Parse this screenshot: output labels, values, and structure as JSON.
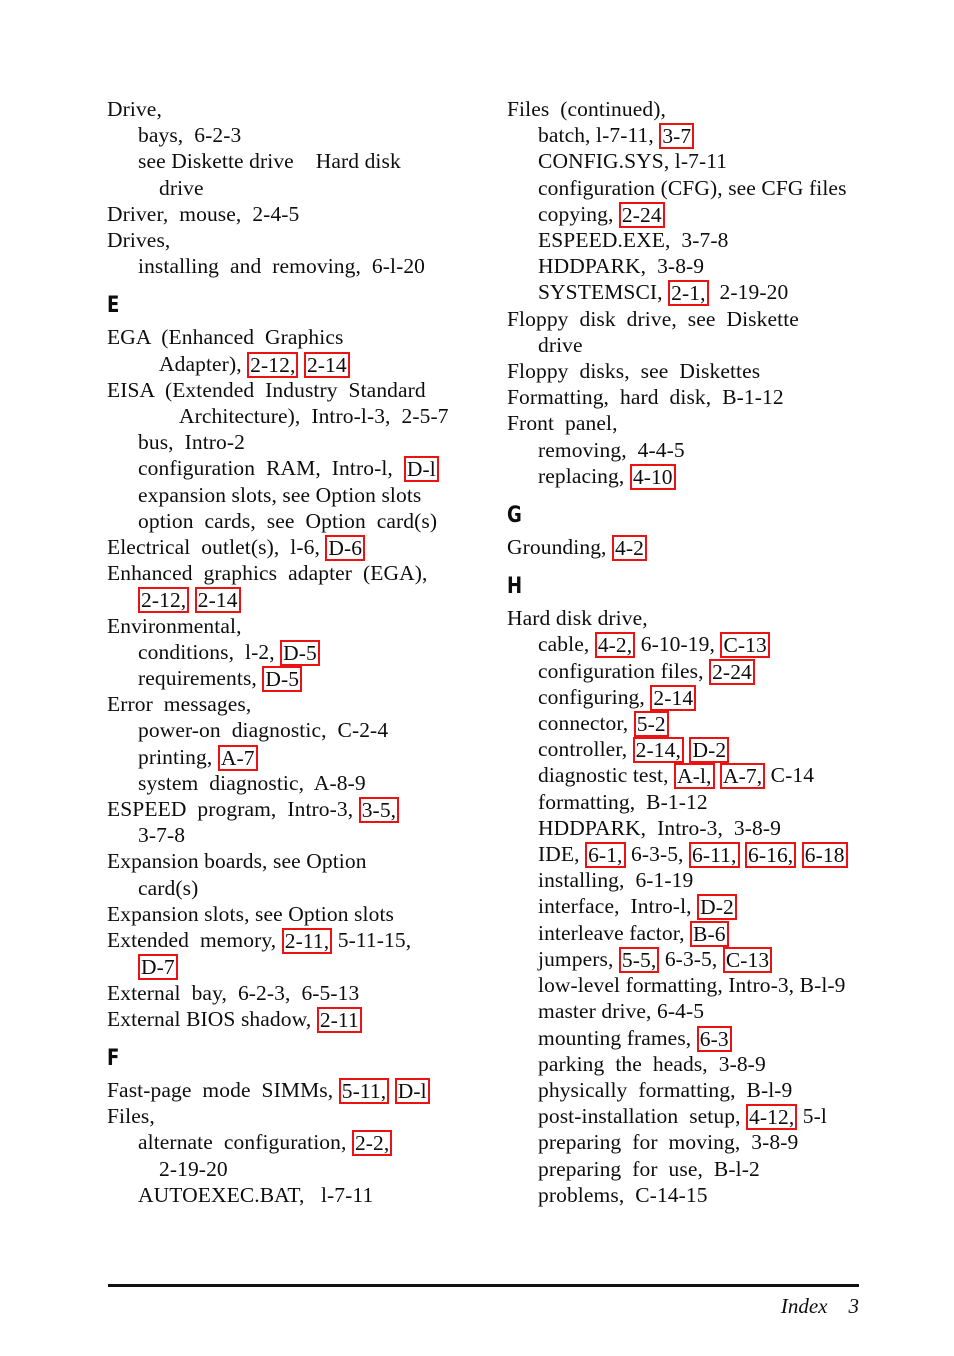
{
  "page": {
    "footer_label": "Index",
    "footer_page_number": "3",
    "highlight_color": "#ee1111"
  },
  "columns": [
    {
      "name": "left-column",
      "blocks": [
        {
          "type": "entries",
          "lines": [
            {
              "indent": 0,
              "parts": [
                {
                  "t": "Drive,"
                }
              ]
            },
            {
              "indent": 1,
              "parts": [
                {
                  "t": "bays,  6-2-3"
                }
              ]
            },
            {
              "indent": 1,
              "parts": [
                {
                  "t": "see Diskette drive    Hard disk"
                }
              ]
            },
            {
              "indent": 2,
              "parts": [
                {
                  "t": "drive"
                }
              ]
            },
            {
              "indent": 0,
              "parts": [
                {
                  "t": "Driver,  mouse,  2-4-5"
                }
              ]
            },
            {
              "indent": 0,
              "parts": [
                {
                  "t": "Drives,"
                }
              ]
            },
            {
              "indent": 1,
              "parts": [
                {
                  "t": "installing  and  removing,  6-l-20"
                }
              ]
            }
          ]
        },
        {
          "type": "section",
          "letter": "E"
        },
        {
          "type": "entries",
          "lines": [
            {
              "indent": 0,
              "parts": [
                {
                  "t": "EGA  (Enhanced  Graphics"
                }
              ]
            },
            {
              "indent": 2,
              "parts": [
                {
                  "t": "Adapter), "
                },
                {
                  "t": "2-12,",
                  "box": true
                },
                {
                  "t": " "
                },
                {
                  "t": "2-14",
                  "box": true
                }
              ]
            },
            {
              "indent": 0,
              "parts": [
                {
                  "t": "EISA  (Extended  Industry  Standard"
                }
              ]
            },
            {
              "indent": 3,
              "parts": [
                {
                  "t": "Architecture),  Intro-l-3,  2-5-7"
                }
              ]
            },
            {
              "indent": 1,
              "parts": [
                {
                  "t": "bus,  Intro-2"
                }
              ]
            },
            {
              "indent": 1,
              "parts": [
                {
                  "t": "configuration  RAM,  Intro-l,  "
                },
                {
                  "t": "D-l",
                  "box": true
                }
              ]
            },
            {
              "indent": 1,
              "parts": [
                {
                  "t": "expansion slots, see Option slots"
                }
              ]
            },
            {
              "indent": 1,
              "parts": [
                {
                  "t": "option  cards,  see  Option  card(s)"
                }
              ]
            },
            {
              "indent": 0,
              "parts": [
                {
                  "t": "Electrical  outlet(s),  l-6, "
                },
                {
                  "t": "D-6",
                  "box": true
                }
              ]
            },
            {
              "indent": 0,
              "parts": [
                {
                  "t": "Enhanced  graphics  adapter  (EGA),"
                }
              ]
            },
            {
              "indent": 1,
              "parts": [
                {
                  "t": "2-12,",
                  "box": true
                },
                {
                  "t": " "
                },
                {
                  "t": "2-14",
                  "box": true
                }
              ]
            },
            {
              "indent": 0,
              "parts": [
                {
                  "t": "Environmental,"
                }
              ]
            },
            {
              "indent": 1,
              "parts": [
                {
                  "t": "conditions,  l-2, "
                },
                {
                  "t": "D-5",
                  "box": true
                }
              ]
            },
            {
              "indent": 1,
              "parts": [
                {
                  "t": "requirements, "
                },
                {
                  "t": "D-5",
                  "box": true
                }
              ]
            },
            {
              "indent": 0,
              "parts": [
                {
                  "t": "Error  messages,"
                }
              ]
            },
            {
              "indent": 1,
              "parts": [
                {
                  "t": "power-on  diagnostic,  C-2-4"
                }
              ]
            },
            {
              "indent": 1,
              "parts": [
                {
                  "t": "printing, "
                },
                {
                  "t": "A-7",
                  "box": true
                }
              ]
            },
            {
              "indent": 1,
              "parts": [
                {
                  "t": "system  diagnostic,  A-8-9"
                }
              ]
            },
            {
              "indent": 0,
              "parts": [
                {
                  "t": "ESPEED  program,  Intro-3, "
                },
                {
                  "t": "3-5,",
                  "box": true
                }
              ]
            },
            {
              "indent": 1,
              "parts": [
                {
                  "t": "3-7-8"
                }
              ]
            },
            {
              "indent": 0,
              "parts": [
                {
                  "t": "Expansion boards, see Option"
                }
              ]
            },
            {
              "indent": 1,
              "parts": [
                {
                  "t": "card(s)"
                }
              ]
            },
            {
              "indent": 0,
              "parts": [
                {
                  "t": "Expansion slots, see Option slots"
                }
              ]
            },
            {
              "indent": 0,
              "parts": [
                {
                  "t": "Extended  memory, "
                },
                {
                  "t": "2-11,",
                  "box": true
                },
                {
                  "t": " 5-11-15,"
                }
              ]
            },
            {
              "indent": 1,
              "parts": [
                {
                  "t": "D-7",
                  "box": true
                }
              ]
            },
            {
              "indent": 0,
              "parts": [
                {
                  "t": "External  bay,  6-2-3,  6-5-13"
                }
              ]
            },
            {
              "indent": 0,
              "parts": [
                {
                  "t": "External BIOS shadow, "
                },
                {
                  "t": "2-11",
                  "box": true
                }
              ]
            }
          ]
        },
        {
          "type": "section",
          "letter": "F"
        },
        {
          "type": "entries",
          "lines": [
            {
              "indent": 0,
              "parts": [
                {
                  "t": "Fast-page  mode  SIMMs, "
                },
                {
                  "t": "5-11,",
                  "box": true
                },
                {
                  "t": " "
                },
                {
                  "t": "D-l",
                  "box": true
                }
              ]
            },
            {
              "indent": 0,
              "parts": [
                {
                  "t": "Files,"
                }
              ]
            },
            {
              "indent": 1,
              "parts": [
                {
                  "t": "alternate  configuration, "
                },
                {
                  "t": "2-2,",
                  "box": true
                }
              ]
            },
            {
              "indent": 2,
              "parts": [
                {
                  "t": "2-19-20"
                }
              ]
            },
            {
              "indent": 1,
              "parts": [
                {
                  "t": "AUTOEXEC.BAT,   l-7-11"
                }
              ]
            }
          ]
        }
      ]
    },
    {
      "name": "right-column",
      "blocks": [
        {
          "type": "entries",
          "lines": [
            {
              "indent": 0,
              "parts": [
                {
                  "t": "Files  (continued),"
                }
              ]
            },
            {
              "indent": 1,
              "parts": [
                {
                  "t": "batch, l-7-11, "
                },
                {
                  "t": "3-7",
                  "box": true
                }
              ]
            },
            {
              "indent": 1,
              "parts": [
                {
                  "t": "CONFIG.SYS, l-7-11"
                }
              ]
            },
            {
              "indent": 1,
              "parts": [
                {
                  "t": "configuration (CFG), see CFG files"
                }
              ]
            },
            {
              "indent": 1,
              "parts": [
                {
                  "t": "copying, "
                },
                {
                  "t": "2-24",
                  "box": true
                }
              ]
            },
            {
              "indent": 1,
              "parts": [
                {
                  "t": "ESPEED.EXE,  3-7-8"
                }
              ]
            },
            {
              "indent": 1,
              "parts": [
                {
                  "t": "HDDPARK,  3-8-9"
                }
              ]
            },
            {
              "indent": 1,
              "parts": [
                {
                  "t": "SYSTEMSCI, "
                },
                {
                  "t": "2-1,",
                  "box": true
                },
                {
                  "t": "  2-19-20"
                }
              ]
            },
            {
              "indent": 0,
              "parts": [
                {
                  "t": "Floppy  disk  drive,  see  Diskette"
                }
              ]
            },
            {
              "indent": 1,
              "parts": [
                {
                  "t": "drive"
                }
              ]
            },
            {
              "indent": 0,
              "parts": [
                {
                  "t": "Floppy  disks,  see  Diskettes"
                }
              ]
            },
            {
              "indent": 0,
              "parts": [
                {
                  "t": "Formatting,  hard  disk,  B-1-12"
                }
              ]
            },
            {
              "indent": 0,
              "parts": [
                {
                  "t": "Front  panel,"
                }
              ]
            },
            {
              "indent": 1,
              "parts": [
                {
                  "t": "removing,  4-4-5"
                }
              ]
            },
            {
              "indent": 1,
              "parts": [
                {
                  "t": "replacing, "
                },
                {
                  "t": "4-10",
                  "box": true
                }
              ]
            }
          ]
        },
        {
          "type": "section",
          "letter": "G"
        },
        {
          "type": "entries",
          "lines": [
            {
              "indent": 0,
              "parts": [
                {
                  "t": "Grounding, "
                },
                {
                  "t": "4-2",
                  "box": true
                }
              ]
            }
          ]
        },
        {
          "type": "section",
          "letter": "H"
        },
        {
          "type": "entries",
          "lines": [
            {
              "indent": 0,
              "parts": [
                {
                  "t": "Hard disk drive,"
                }
              ]
            },
            {
              "indent": 1,
              "parts": [
                {
                  "t": "cable, "
                },
                {
                  "t": "4-2,",
                  "box": true
                },
                {
                  "t": " 6-10-19, "
                },
                {
                  "t": "C-13",
                  "box": true
                }
              ]
            },
            {
              "indent": 1,
              "parts": [
                {
                  "t": "configuration files, "
                },
                {
                  "t": "2-24",
                  "box": true
                }
              ]
            },
            {
              "indent": 1,
              "parts": [
                {
                  "t": "configuring, "
                },
                {
                  "t": "2-14",
                  "box": true
                }
              ]
            },
            {
              "indent": 1,
              "parts": [
                {
                  "t": "connector, "
                },
                {
                  "t": "5-2",
                  "box": true
                }
              ]
            },
            {
              "indent": 1,
              "parts": [
                {
                  "t": "controller, "
                },
                {
                  "t": "2-14,",
                  "box": true
                },
                {
                  "t": " "
                },
                {
                  "t": "D-2",
                  "box": true
                }
              ]
            },
            {
              "indent": 1,
              "parts": [
                {
                  "t": "diagnostic test, "
                },
                {
                  "t": "A-l,",
                  "box": true
                },
                {
                  "t": " "
                },
                {
                  "t": "A-7,",
                  "box": true
                },
                {
                  "t": " C-14"
                }
              ]
            },
            {
              "indent": 1,
              "parts": [
                {
                  "t": "formatting,  B-1-12"
                }
              ]
            },
            {
              "indent": 1,
              "parts": [
                {
                  "t": "HDDPARK,  Intro-3,  3-8-9"
                }
              ]
            },
            {
              "indent": 1,
              "parts": [
                {
                  "t": "IDE, "
                },
                {
                  "t": "6-1,",
                  "box": true
                },
                {
                  "t": " 6-3-5, "
                },
                {
                  "t": "6-11,",
                  "box": true
                },
                {
                  "t": " "
                },
                {
                  "t": "6-16,",
                  "box": true
                },
                {
                  "t": " "
                },
                {
                  "t": "6-18",
                  "box": true
                }
              ]
            },
            {
              "indent": 1,
              "parts": [
                {
                  "t": "installing,  6-1-19"
                }
              ]
            },
            {
              "indent": 1,
              "parts": [
                {
                  "t": "interface,  Intro-l, "
                },
                {
                  "t": "D-2",
                  "box": true
                }
              ]
            },
            {
              "indent": 1,
              "parts": [
                {
                  "t": "interleave factor, "
                },
                {
                  "t": "B-6",
                  "box": true
                }
              ]
            },
            {
              "indent": 1,
              "parts": [
                {
                  "t": "jumpers, "
                },
                {
                  "t": "5-5,",
                  "box": true
                },
                {
                  "t": " 6-3-5, "
                },
                {
                  "t": "C-13",
                  "box": true
                }
              ]
            },
            {
              "indent": 1,
              "parts": [
                {
                  "t": "low-level formatting, Intro-3, B-l-9"
                }
              ]
            },
            {
              "indent": 1,
              "parts": [
                {
                  "t": "master drive, 6-4-5"
                }
              ]
            },
            {
              "indent": 1,
              "parts": [
                {
                  "t": "mounting frames, "
                },
                {
                  "t": "6-3",
                  "box": true
                }
              ]
            },
            {
              "indent": 1,
              "parts": [
                {
                  "t": "parking  the  heads,  3-8-9"
                }
              ]
            },
            {
              "indent": 1,
              "parts": [
                {
                  "t": "physically  formatting,  B-l-9"
                }
              ]
            },
            {
              "indent": 1,
              "parts": [
                {
                  "t": "post-installation  setup, "
                },
                {
                  "t": "4-12,",
                  "box": true
                },
                {
                  "t": " 5-l"
                }
              ]
            },
            {
              "indent": 1,
              "parts": [
                {
                  "t": "preparing  for  moving,  3-8-9"
                }
              ]
            },
            {
              "indent": 1,
              "parts": [
                {
                  "t": "preparing  for  use,  B-l-2"
                }
              ]
            },
            {
              "indent": 1,
              "parts": [
                {
                  "t": "problems,  C-14-15"
                }
              ]
            }
          ]
        }
      ]
    }
  ]
}
